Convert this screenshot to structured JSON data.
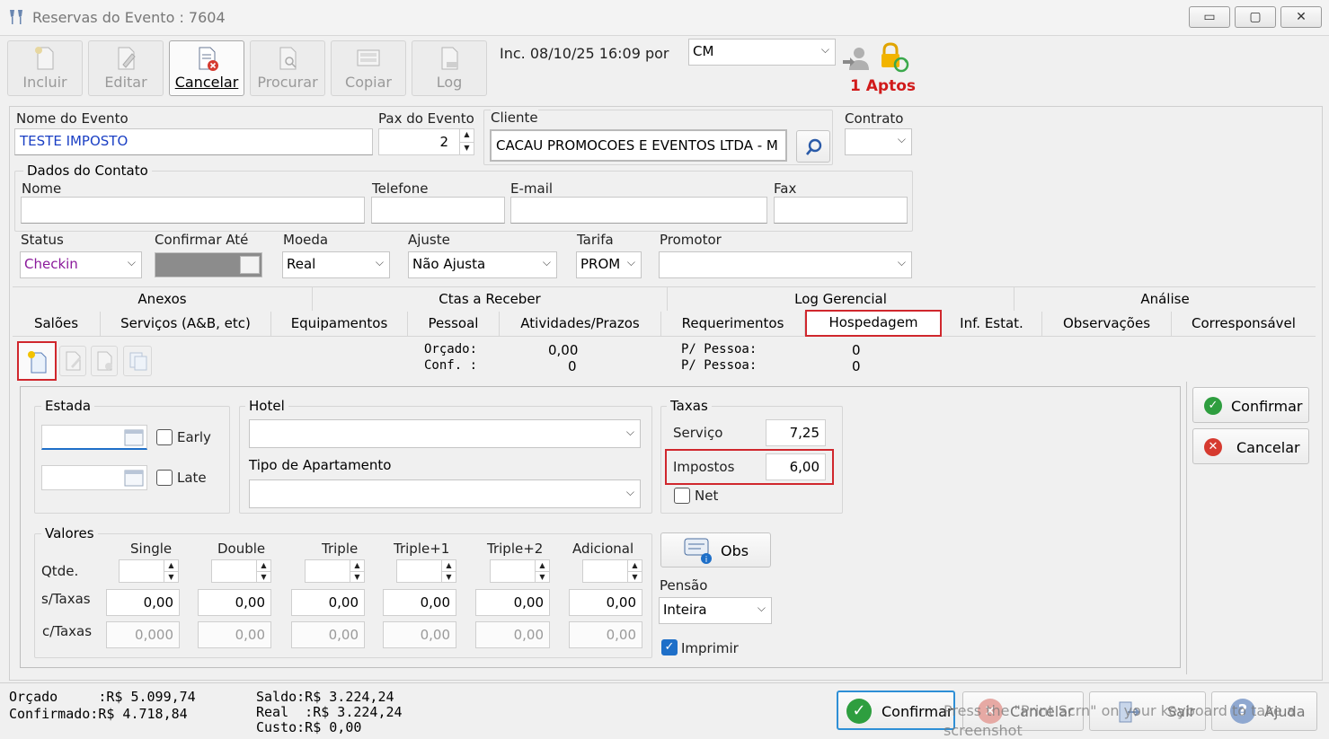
{
  "window": {
    "title": "Reservas do Evento : 7604",
    "controls": {
      "minimize": "▭",
      "maximize": "▢",
      "close": "✕"
    }
  },
  "toolbar": {
    "buttons": [
      {
        "label": "Incluir",
        "icon": "new-document-icon",
        "enabled": false
      },
      {
        "label": "Editar",
        "icon": "edit-document-icon",
        "enabled": false
      },
      {
        "label": "Cancelar",
        "icon": "cancel-document-icon",
        "enabled": true
      },
      {
        "label": "Procurar",
        "icon": "search-document-icon",
        "enabled": false
      },
      {
        "label": "Copiar",
        "icon": "copy-icon",
        "enabled": false
      },
      {
        "label": "Log",
        "icon": "log-icon",
        "enabled": false
      }
    ],
    "inclusion_info": "Inc. 08/10/25 16:09 por",
    "user_combo": "CM",
    "aptos_label": "1 Aptos"
  },
  "event": {
    "name_label": "Nome do Evento",
    "name_value": "TESTE IMPOSTO",
    "pax_label": "Pax do Evento",
    "pax_value": "2",
    "client_label": "Cliente",
    "client_value": "CACAU PROMOCOES E EVENTOS LTDA - M",
    "contract_label": "Contrato",
    "contract_value": ""
  },
  "contact": {
    "group_title": "Dados do Contato",
    "name_label": "Nome",
    "phone_label": "Telefone",
    "email_label": "E-mail",
    "fax_label": "Fax"
  },
  "status_row": {
    "status_label": "Status",
    "status_value": "Checkin",
    "confirm_label": "Confirmar Até",
    "currency_label": "Moeda",
    "currency_value": "Real",
    "adjust_label": "Ajuste",
    "adjust_value": "Não Ajusta",
    "rate_label": "Tarifa",
    "rate_value": "PROM",
    "promoter_label": "Promotor",
    "promoter_value": ""
  },
  "tabs": {
    "top": [
      "Anexos",
      "Ctas a Receber",
      "Log Gerencial",
      "Análise"
    ],
    "bottom": [
      "Salões",
      "Serviços (A&B, etc)",
      "Equipamentos",
      "Pessoal",
      "Atividades/Prazos",
      "Requerimentos",
      "Hospedagem",
      "Inf. Estat.",
      "Observações",
      "Corresponsável"
    ],
    "active": "Hospedagem"
  },
  "summary": {
    "line1": "Orçado:",
    "line1_value": "0,00",
    "line2": "Conf. :",
    "line2_value": "0",
    "per1": "P/ Pessoa:",
    "per1_value": "0",
    "per2": "P/ Pessoa:",
    "per2_value": "0"
  },
  "lodging": {
    "estada_title": "Estada",
    "early_label": "Early",
    "late_label": "Late",
    "hotel_title": "Hotel",
    "hotel_value": "",
    "room_type_title": "Tipo de Apartamento",
    "room_type_value": "",
    "taxes_title": "Taxas",
    "service_label": "Serviço",
    "service_value": "7,25",
    "tax_label": "Impostos",
    "tax_value": "6,00",
    "net_label": "Net",
    "values_title": "Valores",
    "columns": [
      "Single",
      "Double",
      "Triple",
      "Triple+1",
      "Triple+2",
      "Adicional"
    ],
    "row_qty": "Qtde.",
    "row_no_tax": "s/Taxas",
    "row_with_tax": "c/Taxas",
    "no_tax_values": [
      "0,00",
      "0,00",
      "0,00",
      "0,00",
      "0,00",
      "0,00"
    ],
    "with_tax_values": [
      "0,000",
      "0,00",
      "0,00",
      "0,00",
      "0,00",
      "0,00"
    ],
    "obs_button": "Obs",
    "board_label": "Pensão",
    "board_value": "Inteira",
    "print_label": "Imprimir",
    "confirm_button": "Confirmar",
    "cancel_button": "Cancelar"
  },
  "footer": {
    "budget_label": "Orçado     :R$ 5.099,74",
    "confirmed_label": "Confirmado:R$ 4.718,84",
    "balance_label": "Saldo:R$ 3.224,24",
    "real_label": "Real  :R$ 3.224,24",
    "cost_label": "Custo:R$ 0,00",
    "buttons": [
      "Confirmar",
      "Cancelar",
      "Sair",
      "Ajuda"
    ],
    "overlay_line1": "Press the \"Print Scrn\" on your keyboard to take a",
    "overlay_line2": "screenshot"
  },
  "colors": {
    "accent_blue": "#1a3fc4",
    "status_purple": "#8b1a9b",
    "aptos_red": "#d11b1b",
    "highlight_red": "#d0272d",
    "check_green": "#2e9e3f",
    "cancel_red": "#d63a2f"
  }
}
